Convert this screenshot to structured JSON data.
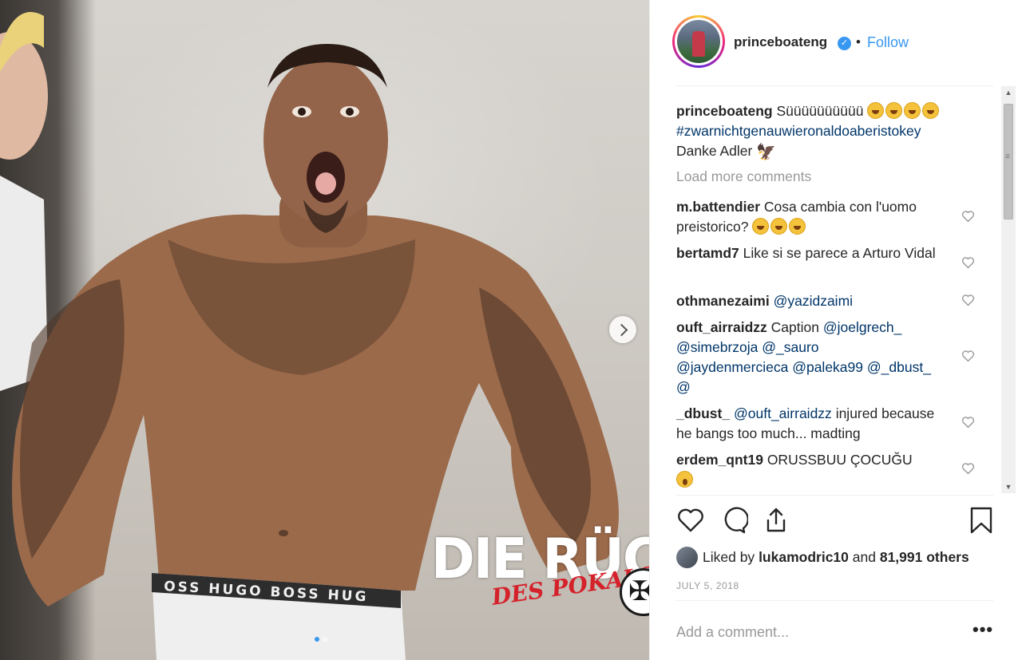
{
  "post": {
    "image_overlay": {
      "title": "DIE RÜCKKEH",
      "subtitle": "DES POKALS"
    },
    "carousel": {
      "slides": 2,
      "active": 1
    }
  },
  "header": {
    "username": "princeboateng",
    "separator": "•",
    "follow_label": "Follow"
  },
  "caption": {
    "username": "princeboateng",
    "text": "Süüüüüüüüüü",
    "hashtag": "#zwarnichtgenauwieronaldoaberistokey",
    "line3": "Danke Adler",
    "emoji_count": 4
  },
  "load_more": "Load more comments",
  "comments": [
    {
      "username": "m.battendier",
      "text": "Cosa cambia con l'uomo preistorico?",
      "emoji": 3
    },
    {
      "username": "bertamd7",
      "text": "Like si se parece a Arturo Vidal"
    },
    {
      "username": "othmanezaimi",
      "mentions": [
        "@yazidzaimi"
      ]
    },
    {
      "username": "ouft_airraidzz",
      "text": "Caption",
      "mentions": [
        "@joelgrech_",
        "@simebrzoja",
        "@_sauro",
        "@jaydenmercieca",
        "@paleka99",
        "@_dbust_",
        "@"
      ]
    },
    {
      "username": "_dbust_",
      "mention": "@ouft_airraidzz",
      "text": "injured because he bangs too much... madting"
    },
    {
      "username": "erdem_qnt19",
      "text": "ORUSSBUU ÇOCUĞU"
    }
  ],
  "likes": {
    "prefix": "Liked by",
    "user": "lukamodric10",
    "middle": "and",
    "others": "81,991 others"
  },
  "date": "JULY 5, 2018",
  "add_comment_placeholder": "Add a comment...",
  "more_label": "•••",
  "icons": [
    "verified-badge-icon",
    "heart-icon",
    "comment-icon",
    "share-icon",
    "bookmark-icon",
    "chevron-right-icon",
    "more-options-icon"
  ],
  "colors": {
    "link_blue": "#3897f0",
    "hashtag": "#003569",
    "muted": "#999999",
    "text": "#262626",
    "overlay_red": "#d5222a"
  }
}
